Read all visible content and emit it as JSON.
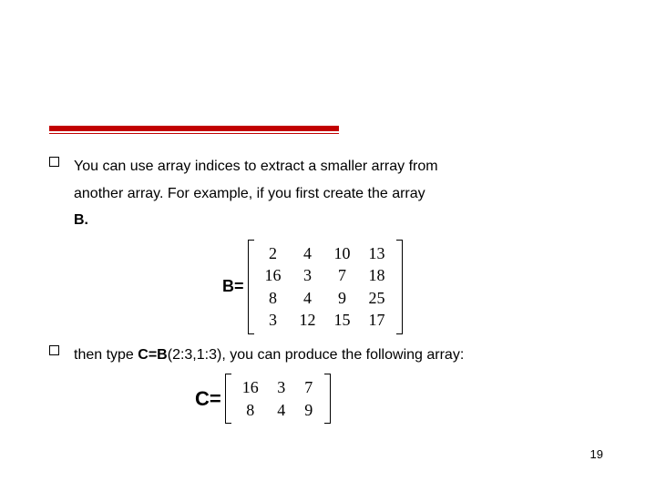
{
  "bullets": {
    "first_a": "You can use array indices to extract a smaller array from",
    "first_b": "another array. For example, if you first create the array",
    "first_c": "B.",
    "second_a": "then type ",
    "second_code": "C=B",
    "second_args": "(2:3,1:3)",
    "second_b": ", you can produce the following array:"
  },
  "labels": {
    "B": "B=",
    "C": "C="
  },
  "matrix_B": [
    [
      2,
      4,
      10,
      13
    ],
    [
      16,
      3,
      7,
      18
    ],
    [
      8,
      4,
      9,
      25
    ],
    [
      3,
      12,
      15,
      17
    ]
  ],
  "matrix_C": [
    [
      16,
      3,
      7
    ],
    [
      8,
      4,
      9
    ]
  ],
  "page_number": "19"
}
